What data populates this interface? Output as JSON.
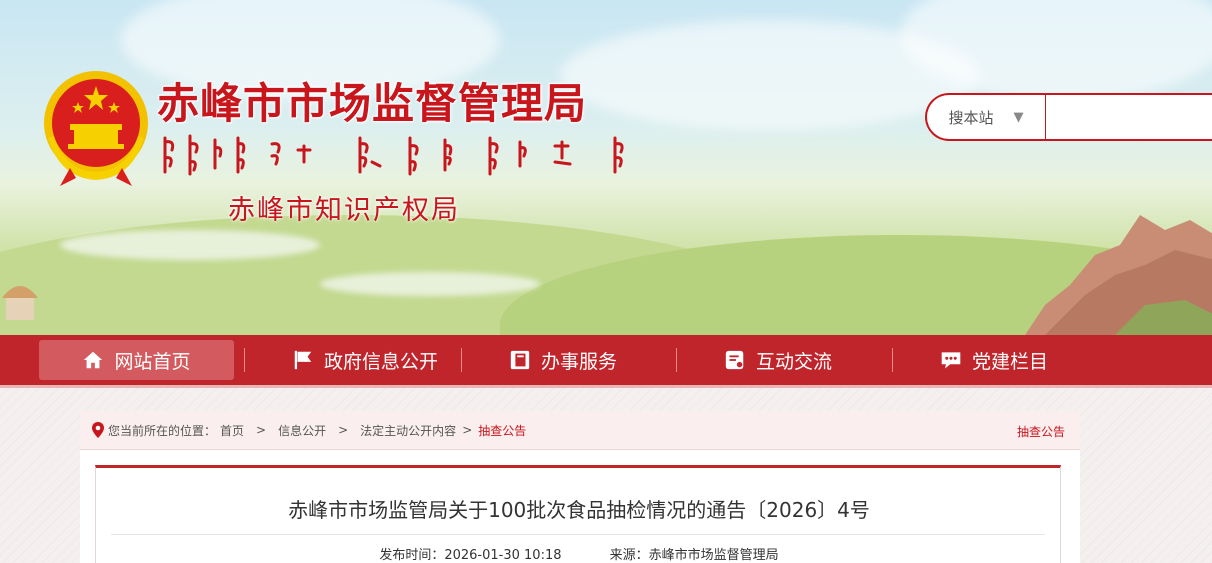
{
  "header": {
    "title": "赤峰市市场监督管理局",
    "subtitle": "赤峰市知识产权局",
    "emblem_icon": "national-emblem-icon"
  },
  "search": {
    "scope_label": "搜本站",
    "placeholder": ""
  },
  "nav": {
    "items": [
      {
        "label": "网站首页",
        "icon": "home-icon"
      },
      {
        "label": "政府信息公开",
        "icon": "flag-icon"
      },
      {
        "label": "办事服务",
        "icon": "service-book-icon"
      },
      {
        "label": "互动交流",
        "icon": "chat-document-icon"
      },
      {
        "label": "党建栏目",
        "icon": "message-bubble-icon"
      }
    ]
  },
  "breadcrumb": {
    "prefix": "您当前所在的位置：",
    "items": [
      "首页",
      "信息公开",
      "法定主动公开内容",
      "抽查公告"
    ],
    "section_label": "抽查公告"
  },
  "article": {
    "title": "赤峰市市场监管局关于100批次食品抽检情况的通告〔2026〕4号",
    "publish_time": "发布时间：2026-01-30 10:18",
    "source": "来源：赤峰市市场监督管理局"
  },
  "colors": {
    "brand_red": "#c0252b",
    "title_red": "#c8161d"
  }
}
